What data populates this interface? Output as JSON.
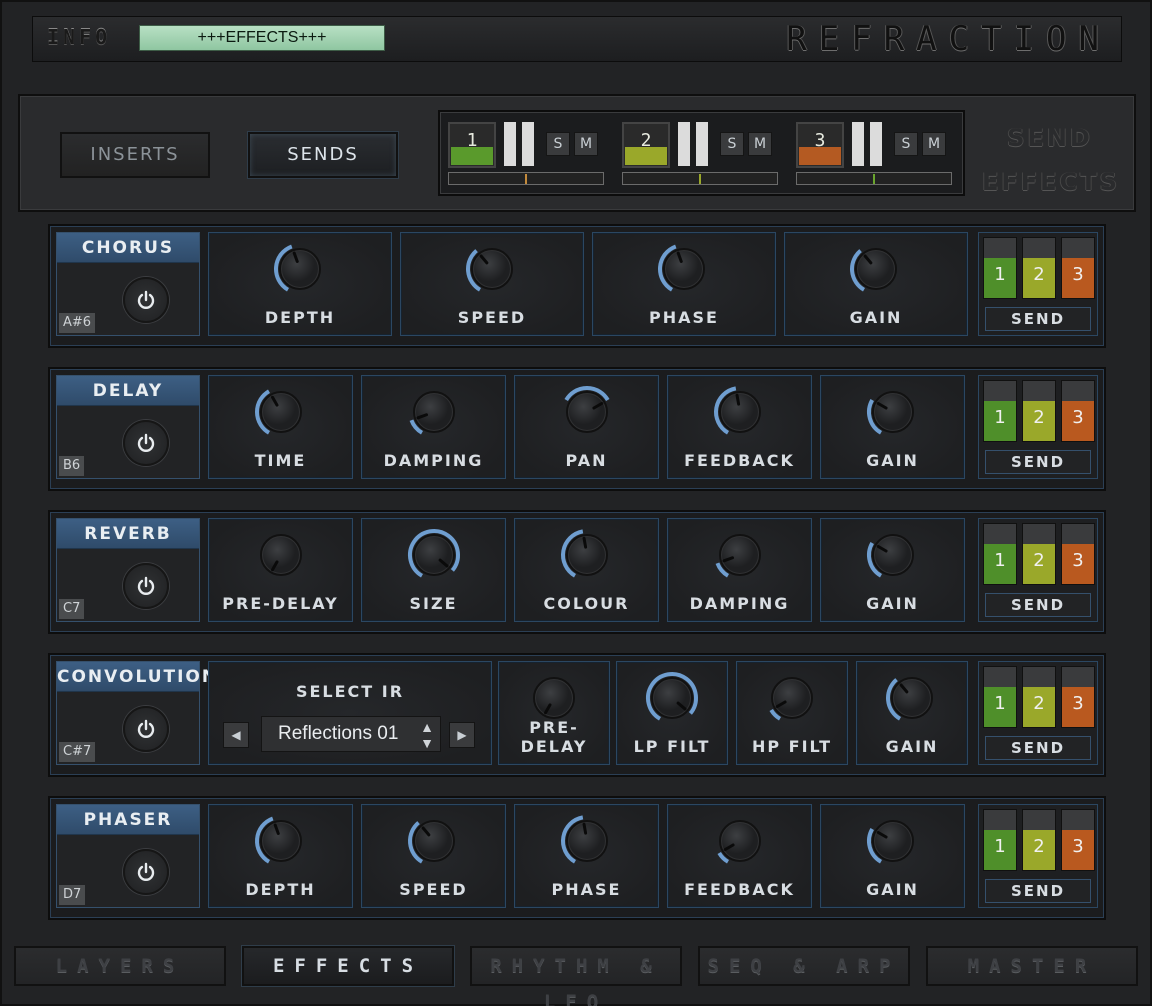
{
  "header": {
    "info_label": "INFO",
    "info_display": "+++EFFECTS+++",
    "logo": "REFRACTION"
  },
  "modes": {
    "inserts": "INSERTS",
    "sends": "SENDS",
    "send_effects": "SEND EFFECTS"
  },
  "channels": [
    {
      "num": "1",
      "color": "#5a9a2c",
      "s": "S",
      "m": "M",
      "marker_color": "#c48a3b"
    },
    {
      "num": "2",
      "color": "#9aa82a",
      "s": "S",
      "m": "M",
      "marker_color": "#9aa82a"
    },
    {
      "num": "3",
      "color": "#b45a22",
      "s": "S",
      "m": "M",
      "marker_color": "#6aa52e"
    }
  ],
  "send_buttons": {
    "b1": "1",
    "b2": "2",
    "b3": "3",
    "label": "SEND"
  },
  "rows": [
    {
      "title": "CHORUS",
      "note": "A#6",
      "knobs": [
        "DEPTH",
        "SPEED",
        "PHASE",
        "GAIN"
      ]
    },
    {
      "title": "DELAY",
      "note": "B6",
      "knobs": [
        "TIME",
        "DAMPING",
        "PAN",
        "FEEDBACK",
        "GAIN"
      ]
    },
    {
      "title": "REVERB",
      "note": "C7",
      "knobs": [
        "PRE-DELAY",
        "SIZE",
        "COLOUR",
        "DAMPING",
        "GAIN"
      ]
    },
    {
      "title": "CONVOLUTION",
      "note": "C#7",
      "select_ir": "SELECT IR",
      "ir_value": "Reflections 01",
      "knobs": [
        "PRE-DELAY",
        "LP FILT",
        "HP FILT",
        "GAIN"
      ]
    },
    {
      "title": "PHASER",
      "note": "D7",
      "knobs": [
        "DEPTH",
        "SPEED",
        "PHASE",
        "FEEDBACK",
        "GAIN"
      ]
    }
  ],
  "colors": {
    "accent": "#6f9ed0",
    "green": "#4f8f2a",
    "yellow": "#9aa82a",
    "orange": "#b9591f"
  },
  "nav": [
    "LAYERS",
    "EFFECTS",
    "RHYTHM & LFO",
    "SEQ & ARP",
    "MASTER"
  ]
}
